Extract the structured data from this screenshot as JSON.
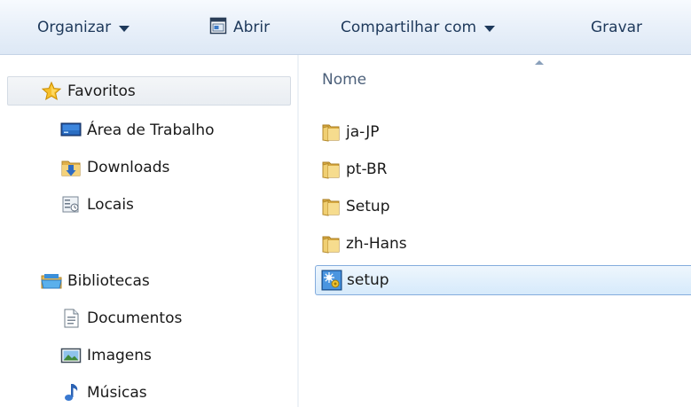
{
  "toolbar": {
    "organize_label": "Organizar",
    "open_label": "Abrir",
    "share_label": "Compartilhar com",
    "burn_label": "Gravar"
  },
  "nav": {
    "favorites": {
      "label": "Favoritos",
      "icon": "star-icon",
      "items": [
        {
          "label": "Área de Trabalho",
          "icon": "desktop-icon"
        },
        {
          "label": "Downloads",
          "icon": "downloads-folder-icon"
        },
        {
          "label": "Locais",
          "icon": "recent-places-icon"
        }
      ]
    },
    "libraries": {
      "label": "Bibliotecas",
      "icon": "libraries-icon",
      "items": [
        {
          "label": "Documentos",
          "icon": "document-icon"
        },
        {
          "label": "Imagens",
          "icon": "pictures-icon"
        },
        {
          "label": "Músicas",
          "icon": "music-icon"
        }
      ]
    }
  },
  "content": {
    "column_name": "Nome",
    "files": [
      {
        "name": "ja-JP",
        "type": "folder",
        "selected": false
      },
      {
        "name": "pt-BR",
        "type": "folder",
        "selected": false
      },
      {
        "name": "Setup",
        "type": "folder",
        "selected": false
      },
      {
        "name": "zh-Hans",
        "type": "folder",
        "selected": false
      },
      {
        "name": "setup",
        "type": "application",
        "selected": true
      }
    ]
  },
  "colors": {
    "toolbar_text": "#1e395b",
    "selection_border": "#84acdd",
    "selection_fill": "#d6eafb",
    "header_text": "#4c607a",
    "folder": "#e8c25a"
  }
}
